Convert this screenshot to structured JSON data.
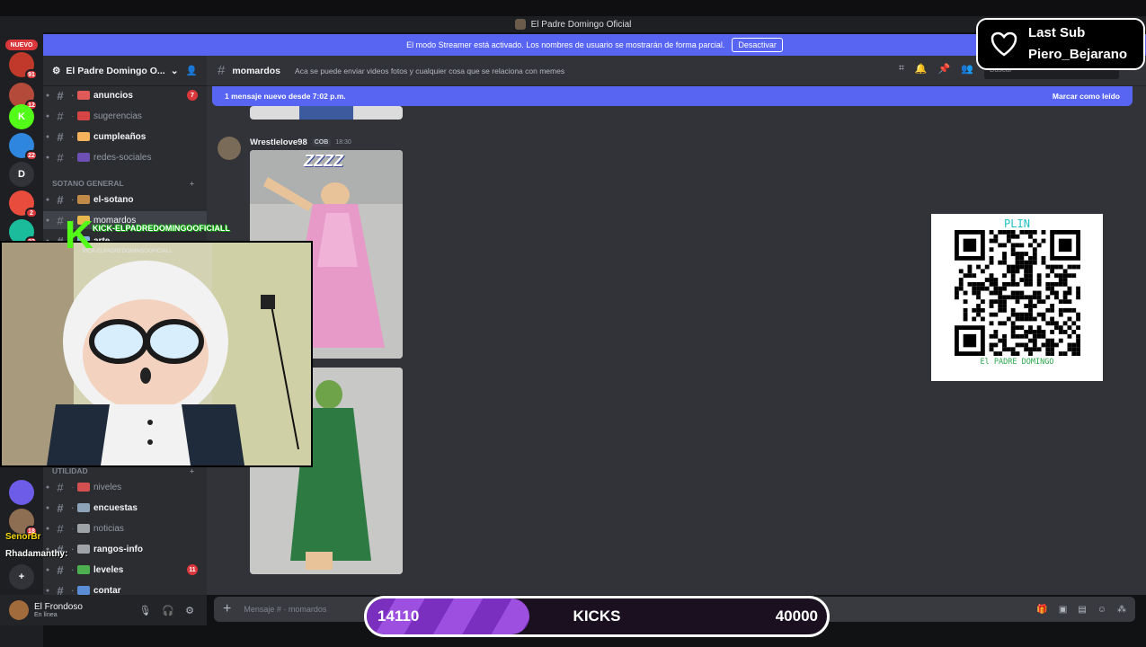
{
  "window": {
    "title": "El Padre Domingo Oficial"
  },
  "servers": {
    "nuevo_label": "NUEVO",
    "items": [
      {
        "name": "server-1",
        "badge": "91",
        "color": "#c0392b"
      },
      {
        "name": "server-2",
        "badge": "12",
        "color": "#b34a3a"
      },
      {
        "name": "kick-server",
        "letter": "K",
        "badge": "",
        "color": "#53fc18"
      },
      {
        "name": "server-4",
        "badge": "22",
        "color": "#2e86de"
      },
      {
        "name": "server-d",
        "letter": "D",
        "badge": "",
        "color": "#313338"
      },
      {
        "name": "server-6",
        "badge": "2",
        "color": "#e74c3c"
      },
      {
        "name": "server-7",
        "badge": "22",
        "color": "#1abc9c"
      },
      {
        "name": "server-8",
        "badge": "",
        "color": "#6c5ce7"
      },
      {
        "name": "server-9",
        "badge": "18",
        "color": "#8e6e53"
      },
      {
        "name": "server-add",
        "letter": "+",
        "badge": "",
        "color": "#313338"
      }
    ]
  },
  "banner": {
    "text": "El modo Streamer está activado. Los nombres de usuario se mostrarán de forma parcial.",
    "button": "Desactivar"
  },
  "guild": {
    "name": "El Padre Domingo O..."
  },
  "channels": [
    {
      "label": "anuncios",
      "bold": true,
      "count": "7",
      "emo": "#e05a5a"
    },
    {
      "label": "sugerencias",
      "bold": false,
      "count": "",
      "emo": "#d64545"
    },
    {
      "label": "cumpleaños",
      "bold": true,
      "count": "",
      "emo": "#f5b35b"
    },
    {
      "label": "redes-sociales",
      "bold": false,
      "count": "",
      "emo": "#6e4fb3"
    },
    {
      "label": "el-sotano",
      "bold": true,
      "count": "",
      "emo": "#c28a48"
    },
    {
      "label": "momardos",
      "bold": false,
      "active": true,
      "count": "",
      "emo": "#e6b84d"
    },
    {
      "label": "arte",
      "bold": true,
      "count": "",
      "emo": "#7fb0e0"
    },
    {
      "label": "niveles",
      "bold": false,
      "count": "",
      "emo": "#d44f4f"
    },
    {
      "label": "encuestas",
      "bold": true,
      "count": "",
      "emo": "#8da3b8"
    },
    {
      "label": "noticias",
      "bold": false,
      "count": "",
      "emo": "#9ea3a8"
    },
    {
      "label": "rangos-info",
      "bold": true,
      "count": "",
      "emo": "#a0a4a8"
    },
    {
      "label": "leveles",
      "bold": true,
      "count": "11",
      "emo": "#4caf50"
    },
    {
      "label": "contar",
      "bold": true,
      "count": "",
      "emo": "#5b8dd6"
    }
  ],
  "categories": {
    "sotano": "SOTANO GENERAL",
    "utilidad": "UTILIDAD"
  },
  "user": {
    "name": "El Frondoso",
    "status": "En línea"
  },
  "header": {
    "channel": "momardos",
    "topic": "Aca se puede enviar videos fotos y cualquier cosa que se relaciona con memes",
    "search": "Buscar"
  },
  "newbar": {
    "text": "1 mensaje nuevo desde 7:02 p.m.",
    "action": "Marcar como leído"
  },
  "message": {
    "author": "Wrestlelove98",
    "tag": "COB",
    "time": "18:30",
    "zzz": "ZZZZ"
  },
  "composer": {
    "placeholder": "Mensaje # · momardos"
  },
  "overlay": {
    "kick_handle": "KICK-ELPADREDOMINGOOFICIALL",
    "kick_handle_small": "KICK-ELPADREDOMINGOOFICIALL",
    "chat1": "SenorBr",
    "chat2": "Rhadamanthy:"
  },
  "lastsub": {
    "title": "Last Sub",
    "name": "Piero_Bejarano"
  },
  "qr": {
    "title": "PLIN",
    "caption": "El PADRE DOMINGO"
  },
  "kicks": {
    "current": "14110",
    "label": "KICKS",
    "goal": "40000",
    "progress": 0.3528
  }
}
